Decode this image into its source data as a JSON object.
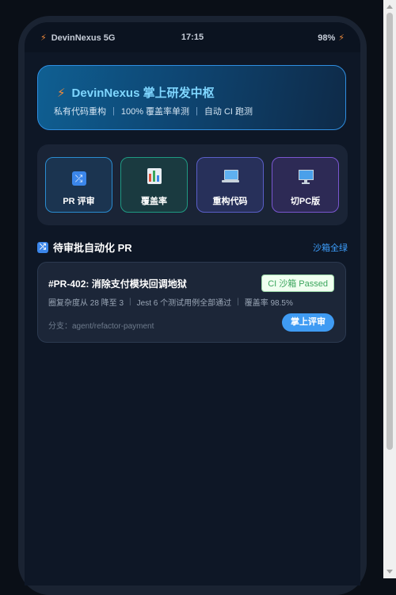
{
  "statusbar": {
    "network": "DevinNexus 5G",
    "time": "17:15",
    "battery": "98%",
    "icon": "bolt-icon"
  },
  "hero": {
    "title": "DevinNexus 掌上研发中枢",
    "features": [
      "私有代码重构",
      "100% 覆盖率单测",
      "自动 CI 跑测"
    ],
    "separator": "|"
  },
  "actions": [
    {
      "label": "PR 评审",
      "icon": "shuffle-icon"
    },
    {
      "label": "覆盖率",
      "icon": "bar-chart-icon"
    },
    {
      "label": "重构代码",
      "icon": "laptop-icon"
    },
    {
      "label": "切PC版",
      "icon": "desktop-monitor-icon"
    }
  ],
  "section": {
    "title": "待审批自动化 PR",
    "link": "沙箱全绿",
    "icon": "shuffle-icon"
  },
  "pr_card": {
    "title": "#PR-402: 消除支付模块回调地狱",
    "badge": "CI 沙箱 Passed",
    "meta": [
      "圈复杂度从 28 降至 3",
      "Jest 6 个测试用例全部通过",
      "覆盖率 98.5%"
    ],
    "branch": "分支：agent/refactor-payment",
    "button": "掌上评审"
  },
  "colors": {
    "accent": "#3ea0ff",
    "bolt": "#f08a3a",
    "success": "#3ba55d"
  }
}
